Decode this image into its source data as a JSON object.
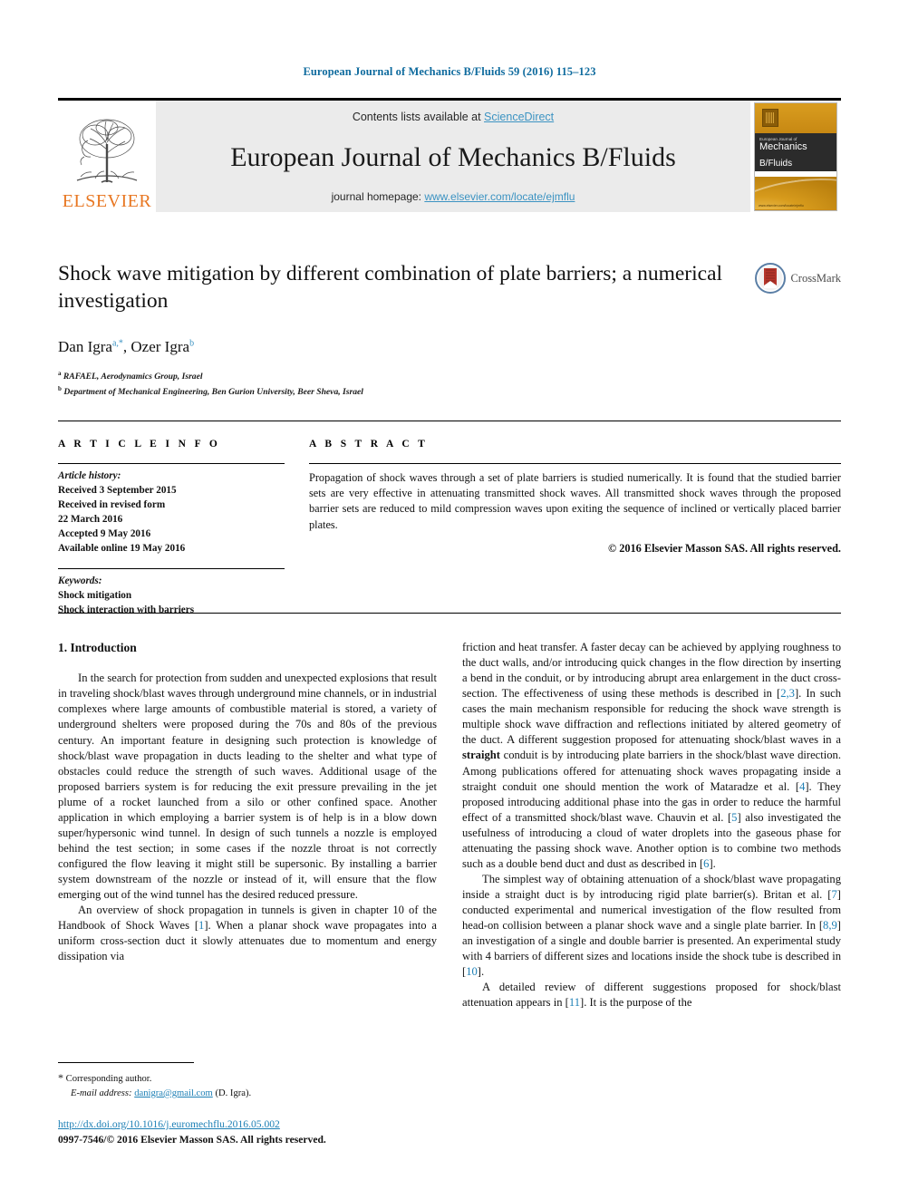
{
  "running_head": "European Journal of Mechanics B/Fluids 59 (2016) 115–123",
  "masthead": {
    "publisher_name": "ELSEVIER",
    "contents_prefix": "Contents lists available at ",
    "contents_link": "ScienceDirect",
    "journal_title": "European Journal of Mechanics B/Fluids",
    "homepage_prefix": "journal homepage: ",
    "homepage_link": "www.elsevier.com/locate/ejmflu",
    "cover": {
      "kicker": "European Journal of",
      "line1": "Mechanics",
      "line2": "B/Fluids",
      "url": "www.elsevier.com/locate/ejmflu"
    }
  },
  "article": {
    "title": "Shock wave mitigation by different combination of plate barriers; a numerical investigation",
    "crossmark_label": "CrossMark",
    "authors": [
      {
        "name": "Dan Igra",
        "marks": "a,*"
      },
      {
        "name": "Ozer Igra",
        "marks": "b"
      }
    ],
    "affiliations": [
      {
        "mark": "a",
        "text": "RAFAEL, Aerodynamics Group, Israel"
      },
      {
        "mark": "b",
        "text": "Department of Mechanical Engineering, Ben Gurion University, Beer Sheva, Israel"
      }
    ]
  },
  "article_info": {
    "heading": "A R T I C L E   I N F O",
    "history_label": "Article history:",
    "history": [
      "Received 3 September 2015",
      "Received in revised form",
      "22 March 2016",
      "Accepted 9 May 2016",
      "Available online 19 May 2016"
    ],
    "keywords_label": "Keywords:",
    "keywords": [
      "Shock mitigation",
      "Shock interaction with barriers"
    ]
  },
  "abstract": {
    "heading": "A B S T R A C T",
    "text": "Propagation of shock waves through a set of plate barriers is studied numerically. It is found that the studied barrier sets are very effective in attenuating transmitted shock waves. All transmitted shock waves through the proposed barrier sets are reduced to mild compression waves upon exiting the sequence of inclined or vertically placed barrier plates.",
    "copyright": "© 2016 Elsevier Masson SAS. All rights reserved."
  },
  "body": {
    "section_title": "1. Introduction",
    "left_paragraphs": [
      "In the search for protection from sudden and unexpected explosions that result in traveling shock/blast waves through underground mine channels, or in industrial complexes where large amounts of combustible material is stored, a variety of underground shelters were proposed during the 70s and 80s of the previous century. An important feature in designing such protection is knowledge of shock/blast wave propagation in ducts leading to the shelter and what type of obstacles could reduce the strength of such waves. Additional usage of the proposed barriers system is for reducing the exit pressure prevailing in the jet plume of a rocket launched from a silo or other confined space. Another application in which employing a barrier system is of help is in a blow down super/hypersonic wind tunnel. In design of such tunnels a nozzle is employed behind the test section; in some cases if the nozzle throat is not correctly configured the flow leaving it might still be supersonic. By installing a barrier system downstream of the nozzle or instead of it, will ensure that the flow emerging out of the wind tunnel has the desired reduced pressure."
    ],
    "left_paragraph_2_pre": "An overview of shock propagation in tunnels is given in chapter 10 of the Handbook of Shock Waves [",
    "left_paragraph_2_ref": "1",
    "left_paragraph_2_post": "]. When a planar shock wave propagates into a uniform cross-section duct it slowly attenuates due to momentum and energy dissipation via",
    "right_p1_a": "friction and heat transfer. A faster decay can be achieved by applying roughness to the duct walls, and/or introducing quick changes in the flow direction by inserting a bend in the conduit, or by introducing abrupt area enlargement in the duct cross-section. The effectiveness of using these methods is described in [",
    "right_p1_ref1": "2,3",
    "right_p1_b": "]. In such cases the main mechanism responsible for reducing the shock wave strength is multiple shock wave diffraction and reflections initiated by altered geometry of the duct. A different suggestion proposed for attenuating shock/blast waves in a ",
    "right_p1_bold": "straight",
    "right_p1_c": " conduit is by introducing plate barriers in the shock/blast wave direction. Among publications offered for attenuating shock waves propagating inside a straight conduit one should mention the work of Mataradze et al. [",
    "right_p1_ref2": "4",
    "right_p1_d": "]. They proposed introducing additional phase into the gas in order to reduce the harmful effect of a transmitted shock/blast wave. Chauvin et al. [",
    "right_p1_ref3": "5",
    "right_p1_e": "] also investigated the usefulness of introducing a cloud of water droplets into the gaseous phase for attenuating the passing shock wave. Another option is to combine two methods such as a double bend duct and dust as described in [",
    "right_p1_ref4": "6",
    "right_p1_f": "].",
    "right_p2_a": "The simplest way of obtaining attenuation of a shock/blast wave propagating inside a straight duct is by introducing rigid plate barrier(s). Britan et al. [",
    "right_p2_ref1": "7",
    "right_p2_b": "] conducted experimental and numerical investigation of the flow resulted from head-on collision between a planar shock wave and a single plate barrier. In [",
    "right_p2_ref2": "8,9",
    "right_p2_c": "] an investigation of a single and double barrier is presented. An experimental study with 4 barriers of different sizes and locations inside the shock tube is described in [",
    "right_p2_ref3": "10",
    "right_p2_d": "].",
    "right_p3_a": "A detailed review of different suggestions proposed for shock/blast attenuation appears in [",
    "right_p3_ref1": "11",
    "right_p3_b": "]. It is the purpose of the"
  },
  "footnote": {
    "star": "*",
    "corresponding": "Corresponding author.",
    "email_label": "E-mail address:",
    "email": "danigra@gmail.com",
    "email_suffix": "(D. Igra)."
  },
  "footer": {
    "doi": "http://dx.doi.org/10.1016/j.euromechflu.2016.05.002",
    "issn_copyright": "0997-7546/© 2016 Elsevier Masson SAS. All rights reserved."
  },
  "colors": {
    "link_blue": "#3C93C2",
    "ref_blue": "#1c7fb5",
    "running_head_blue": "#0f6b9e",
    "elsevier_orange": "#E87722",
    "masthead_grey": "#ebebeb"
  }
}
